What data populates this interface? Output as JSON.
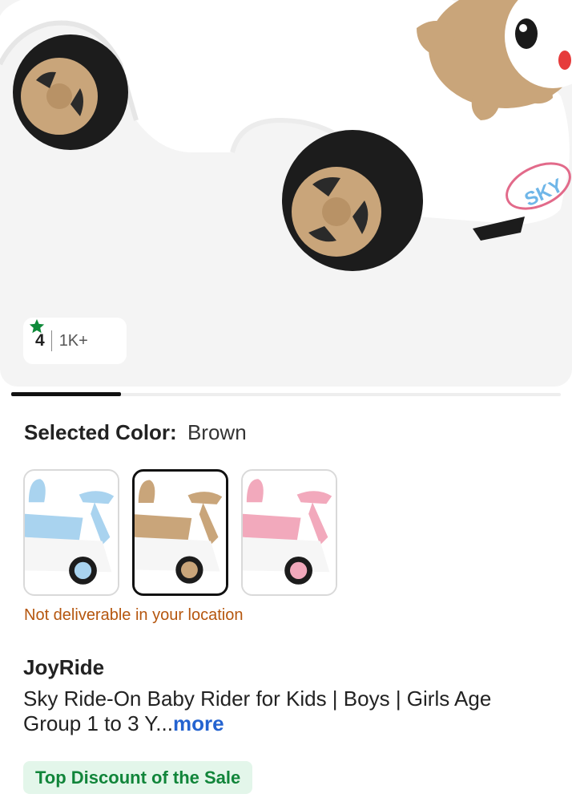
{
  "product_image": {
    "logo_text": "SKY",
    "colors": {
      "body": "#ffffff",
      "accent": "#c9a57a",
      "tire": "#1c1c1c",
      "background": "#f4f4f4"
    }
  },
  "rating": {
    "value": "4",
    "count": "1K+",
    "star_color": "#0f8a3a"
  },
  "carousel": {
    "total_pages": 5,
    "active_page": 1
  },
  "color_selector": {
    "label": "Selected Color:",
    "value": "Brown",
    "options": [
      {
        "name": "Blue",
        "seat_color": "#a9d3ef",
        "selected": false
      },
      {
        "name": "Brown",
        "seat_color": "#c9a57a",
        "selected": true
      },
      {
        "name": "Pink",
        "seat_color": "#f2a9bc",
        "selected": false
      }
    ]
  },
  "delivery_note": "Not deliverable in your location",
  "product": {
    "brand": "JoyRide",
    "title": "Sky Ride-On Baby Rider for Kids | Boys | Girls Age Group 1 to 3 Y...",
    "more_label": "more"
  },
  "badge": {
    "label": "Top Discount of the Sale",
    "color": "#11853a"
  }
}
